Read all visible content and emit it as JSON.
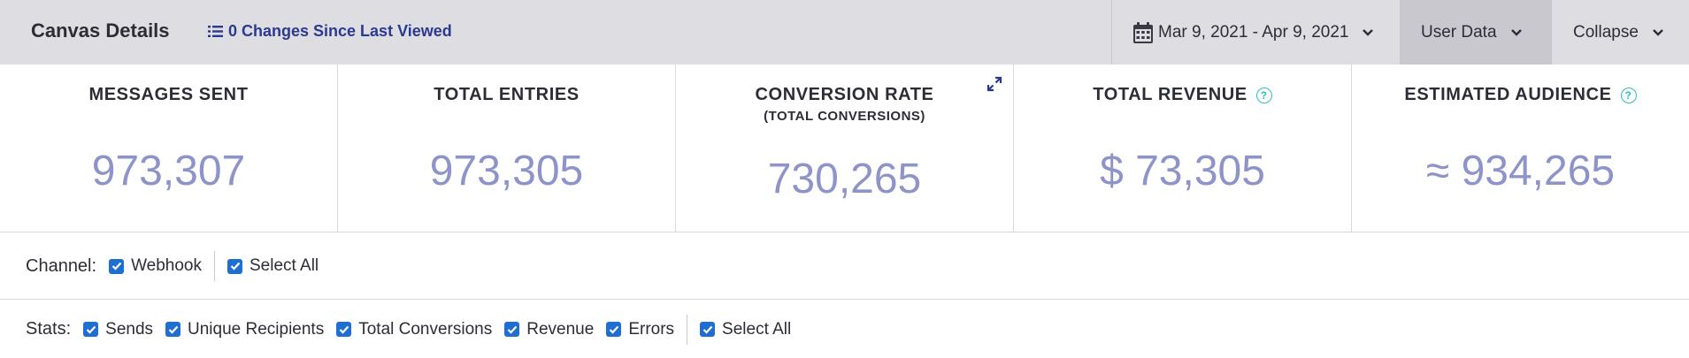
{
  "header": {
    "title": "Canvas Details",
    "changes_label": "0 Changes Since Last Viewed",
    "date_range": "Mar 9, 2021 - Apr 9, 2021",
    "user_data_label": "User Data",
    "collapse_label": "Collapse"
  },
  "kpis": [
    {
      "title": "MESSAGES SENT",
      "value": "973,307"
    },
    {
      "title": "TOTAL ENTRIES",
      "value": "973,305"
    },
    {
      "title": "CONVERSION RATE",
      "subtitle": "(TOTAL CONVERSIONS)",
      "value": "730,265"
    },
    {
      "title": "TOTAL REVENUE",
      "value": "$ 73,305",
      "help": "?"
    },
    {
      "title": "ESTIMATED AUDIENCE",
      "value": "≈ 934,265",
      "help": "?"
    }
  ],
  "channel": {
    "label": "Channel:",
    "options": [
      "Webhook"
    ],
    "select_all": "Select All"
  },
  "stats": {
    "label": "Stats:",
    "options": [
      "Sends",
      "Unique Recipients",
      "Total Conversions",
      "Revenue",
      "Errors"
    ],
    "select_all": "Select All"
  },
  "colors": {
    "header_bg": "#dedde2",
    "accent_link": "#2b3a8f",
    "kpi_value": "#8e93c8",
    "checkbox": "#1f6fd1",
    "help_icon": "#31b9c6"
  },
  "icons": {
    "list": "list-icon",
    "calendar": "calendar-icon",
    "chevron": "chevron-down-icon",
    "expand": "expand-icon",
    "help": "help-circle-icon",
    "checkbox": "checkbox-checked-icon"
  }
}
